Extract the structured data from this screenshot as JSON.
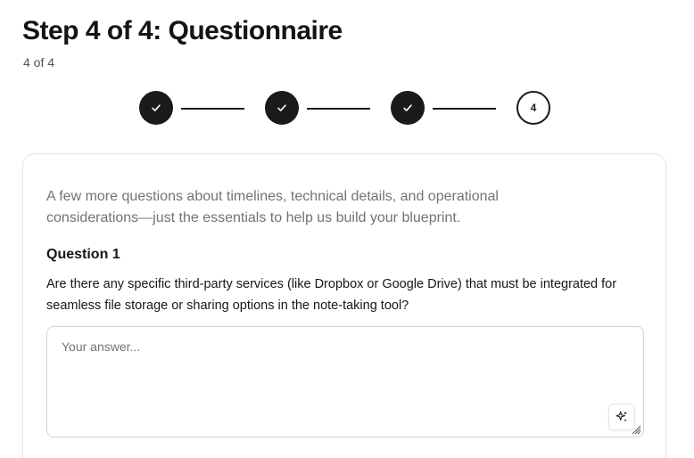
{
  "header": {
    "title": "Step 4 of 4: Questionnaire",
    "step_counter": "4 of 4"
  },
  "stepper": {
    "steps": [
      {
        "status": "completed",
        "icon": "check-icon"
      },
      {
        "status": "completed",
        "icon": "check-icon"
      },
      {
        "status": "completed",
        "icon": "check-icon"
      },
      {
        "status": "current",
        "label": "4"
      }
    ]
  },
  "card": {
    "intro": "A few more questions about timelines, technical details, and operational considerations—just the essentials to help us build your blueprint.",
    "question": {
      "title": "Question 1",
      "text": "Are there any specific third-party services (like Dropbox or Google Drive) that must be integrated for seamless file storage or sharing options in the note-taking tool?",
      "answer_value": "",
      "answer_placeholder": "Your answer...",
      "assist_icon": "sparkles-icon"
    }
  },
  "colors": {
    "step_fill": "#1a1a1a",
    "muted_text": "#737373",
    "border": "#e5e5e5"
  }
}
